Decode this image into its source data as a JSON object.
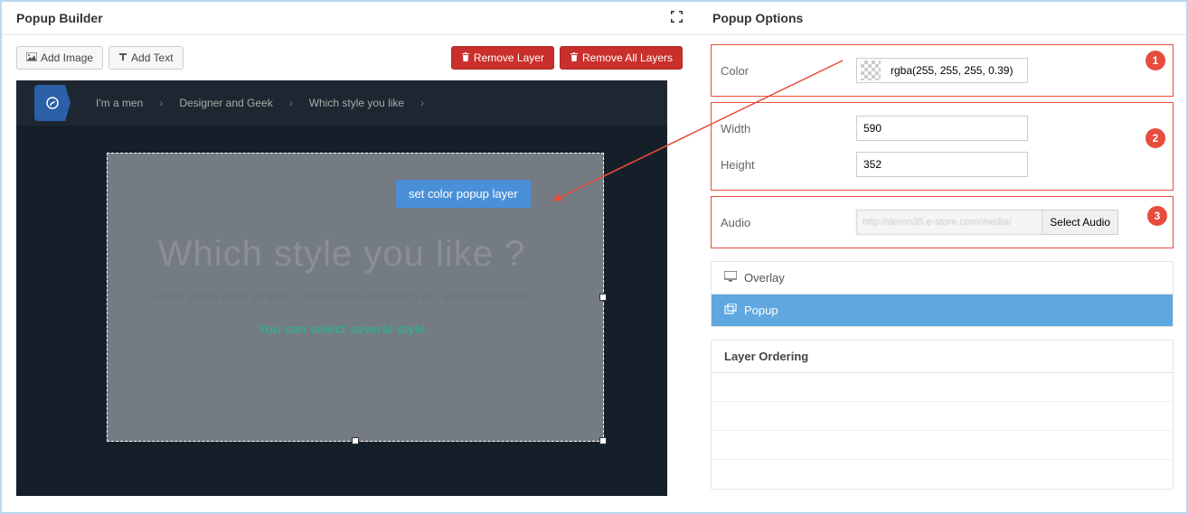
{
  "header": {
    "title": "Popup Builder"
  },
  "toolbar": {
    "add_image": "Add Image",
    "add_text": "Add Text",
    "remove_layer": "Remove Layer",
    "remove_all": "Remove All Layers"
  },
  "canvas": {
    "breadcrumb": [
      "I'm a men",
      "Designer and Geek",
      "Which style you like"
    ],
    "title": "Which style you like ?",
    "subtitle": "lorem ipsum dolor sit amet, consectetur adipisicing elit, sed do eiusmod.",
    "tagline": "You can select several style",
    "callout": "set color popup layer"
  },
  "options": {
    "title": "Popup Options",
    "color_label": "Color",
    "color_value": "rgba(255, 255, 255, 0.39)",
    "width_label": "Width",
    "width_value": "590",
    "height_label": "Height",
    "height_value": "352",
    "audio_label": "Audio",
    "audio_placeholder": "http://demo35.e-store.com/media/",
    "audio_button": "Select Audio",
    "badges": {
      "one": "1",
      "two": "2",
      "three": "3"
    }
  },
  "sections": {
    "overlay": "Overlay",
    "popup": "Popup"
  },
  "layer_ordering": {
    "title": "Layer Ordering"
  }
}
